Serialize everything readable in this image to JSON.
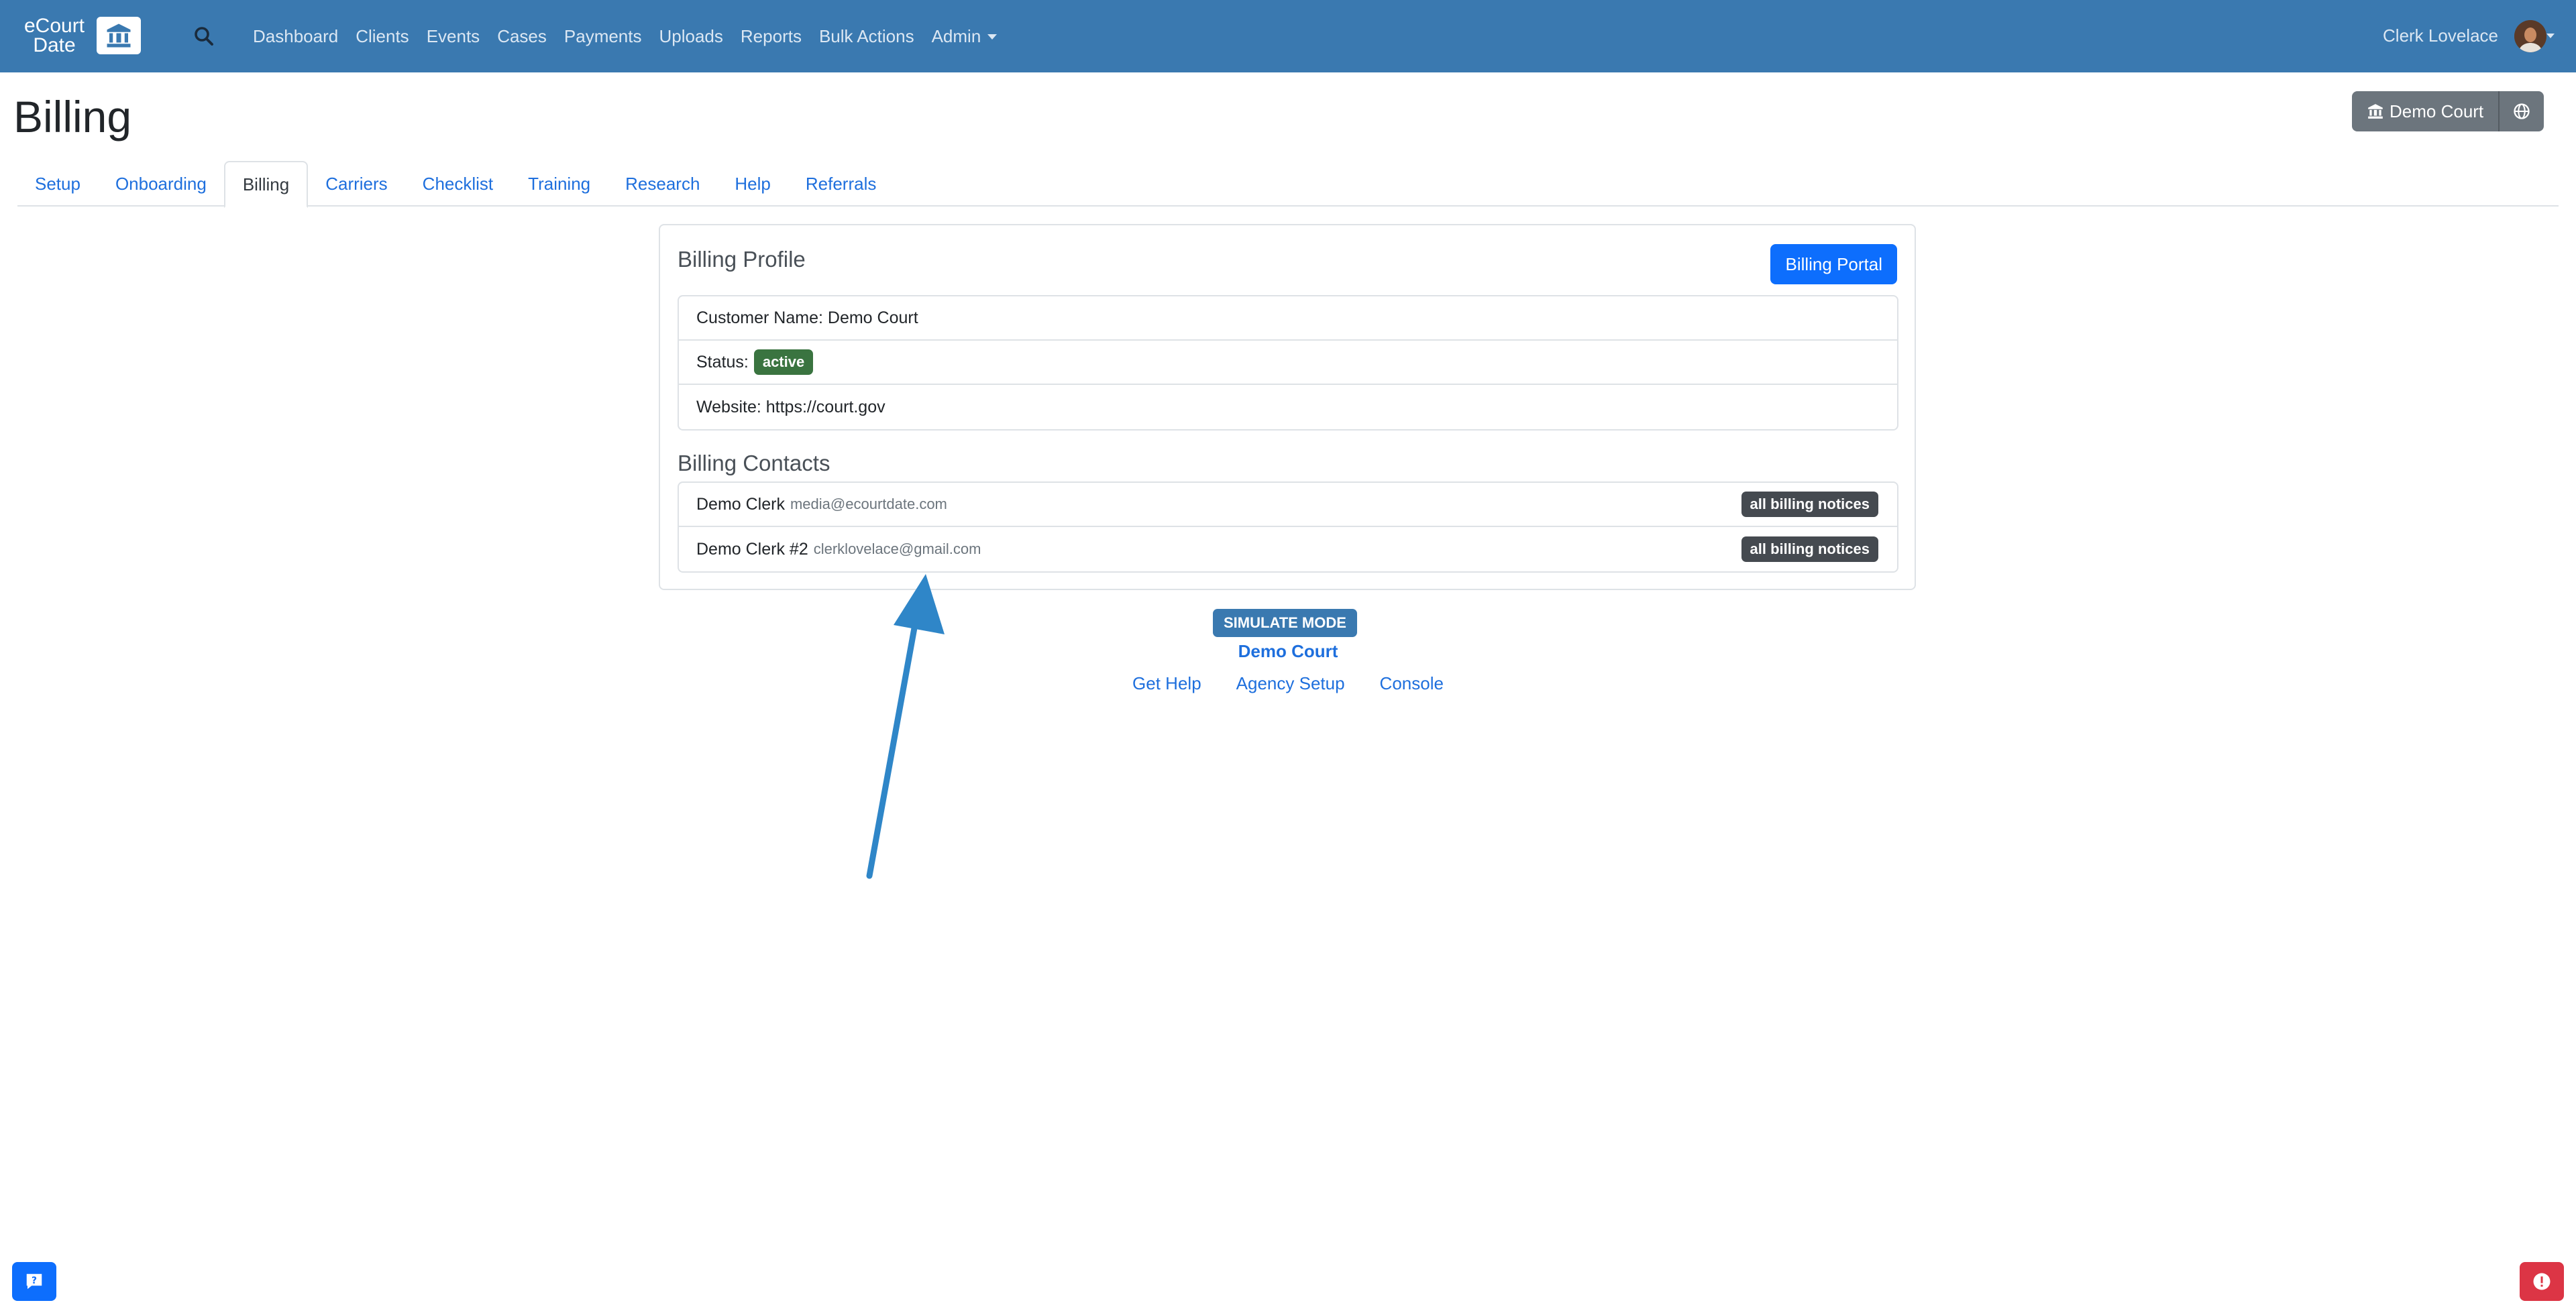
{
  "navbar": {
    "brand_line1": "eCourt",
    "brand_line2": "Date",
    "links": [
      "Dashboard",
      "Clients",
      "Events",
      "Cases",
      "Payments",
      "Uploads",
      "Reports",
      "Bulk Actions",
      "Admin"
    ],
    "user_name": "Clerk Lovelace",
    "background_color": "#3a79b0"
  },
  "page": {
    "title": "Billing",
    "court_button": "Demo Court"
  },
  "tabs": [
    "Setup",
    "Onboarding",
    "Billing",
    "Carriers",
    "Checklist",
    "Training",
    "Research",
    "Help",
    "Referrals"
  ],
  "active_tab": "Billing",
  "billing_profile": {
    "title": "Billing Profile",
    "portal_button": "Billing Portal",
    "customer_name": "Customer Name: Demo Court",
    "status_label": "Status:",
    "status_value": "active",
    "website": "Website: https://court.gov"
  },
  "billing_contacts": {
    "title": "Billing Contacts",
    "contacts": [
      {
        "name": "Demo Clerk",
        "email": "media@ecourtdate.com",
        "badge": "all billing notices"
      },
      {
        "name": "Demo Clerk #2",
        "email": "clerklovelace@gmail.com",
        "badge": "all billing notices"
      }
    ]
  },
  "footer": {
    "simulate_badge": "SIMULATE MODE",
    "court_name": "Demo Court",
    "links": [
      "Get Help",
      "Agency Setup",
      "Console"
    ]
  },
  "icons": {
    "search": "search-icon",
    "court": "bank-icon",
    "globe": "globe-icon",
    "help": "question-chat-icon",
    "alert": "exclamation-icon"
  },
  "colors": {
    "primary": "#0d6efd",
    "success_badge": "#3a7440",
    "dark_badge": "#454a50",
    "danger": "#dc3545",
    "annotation_arrow": "#2f86c8"
  }
}
